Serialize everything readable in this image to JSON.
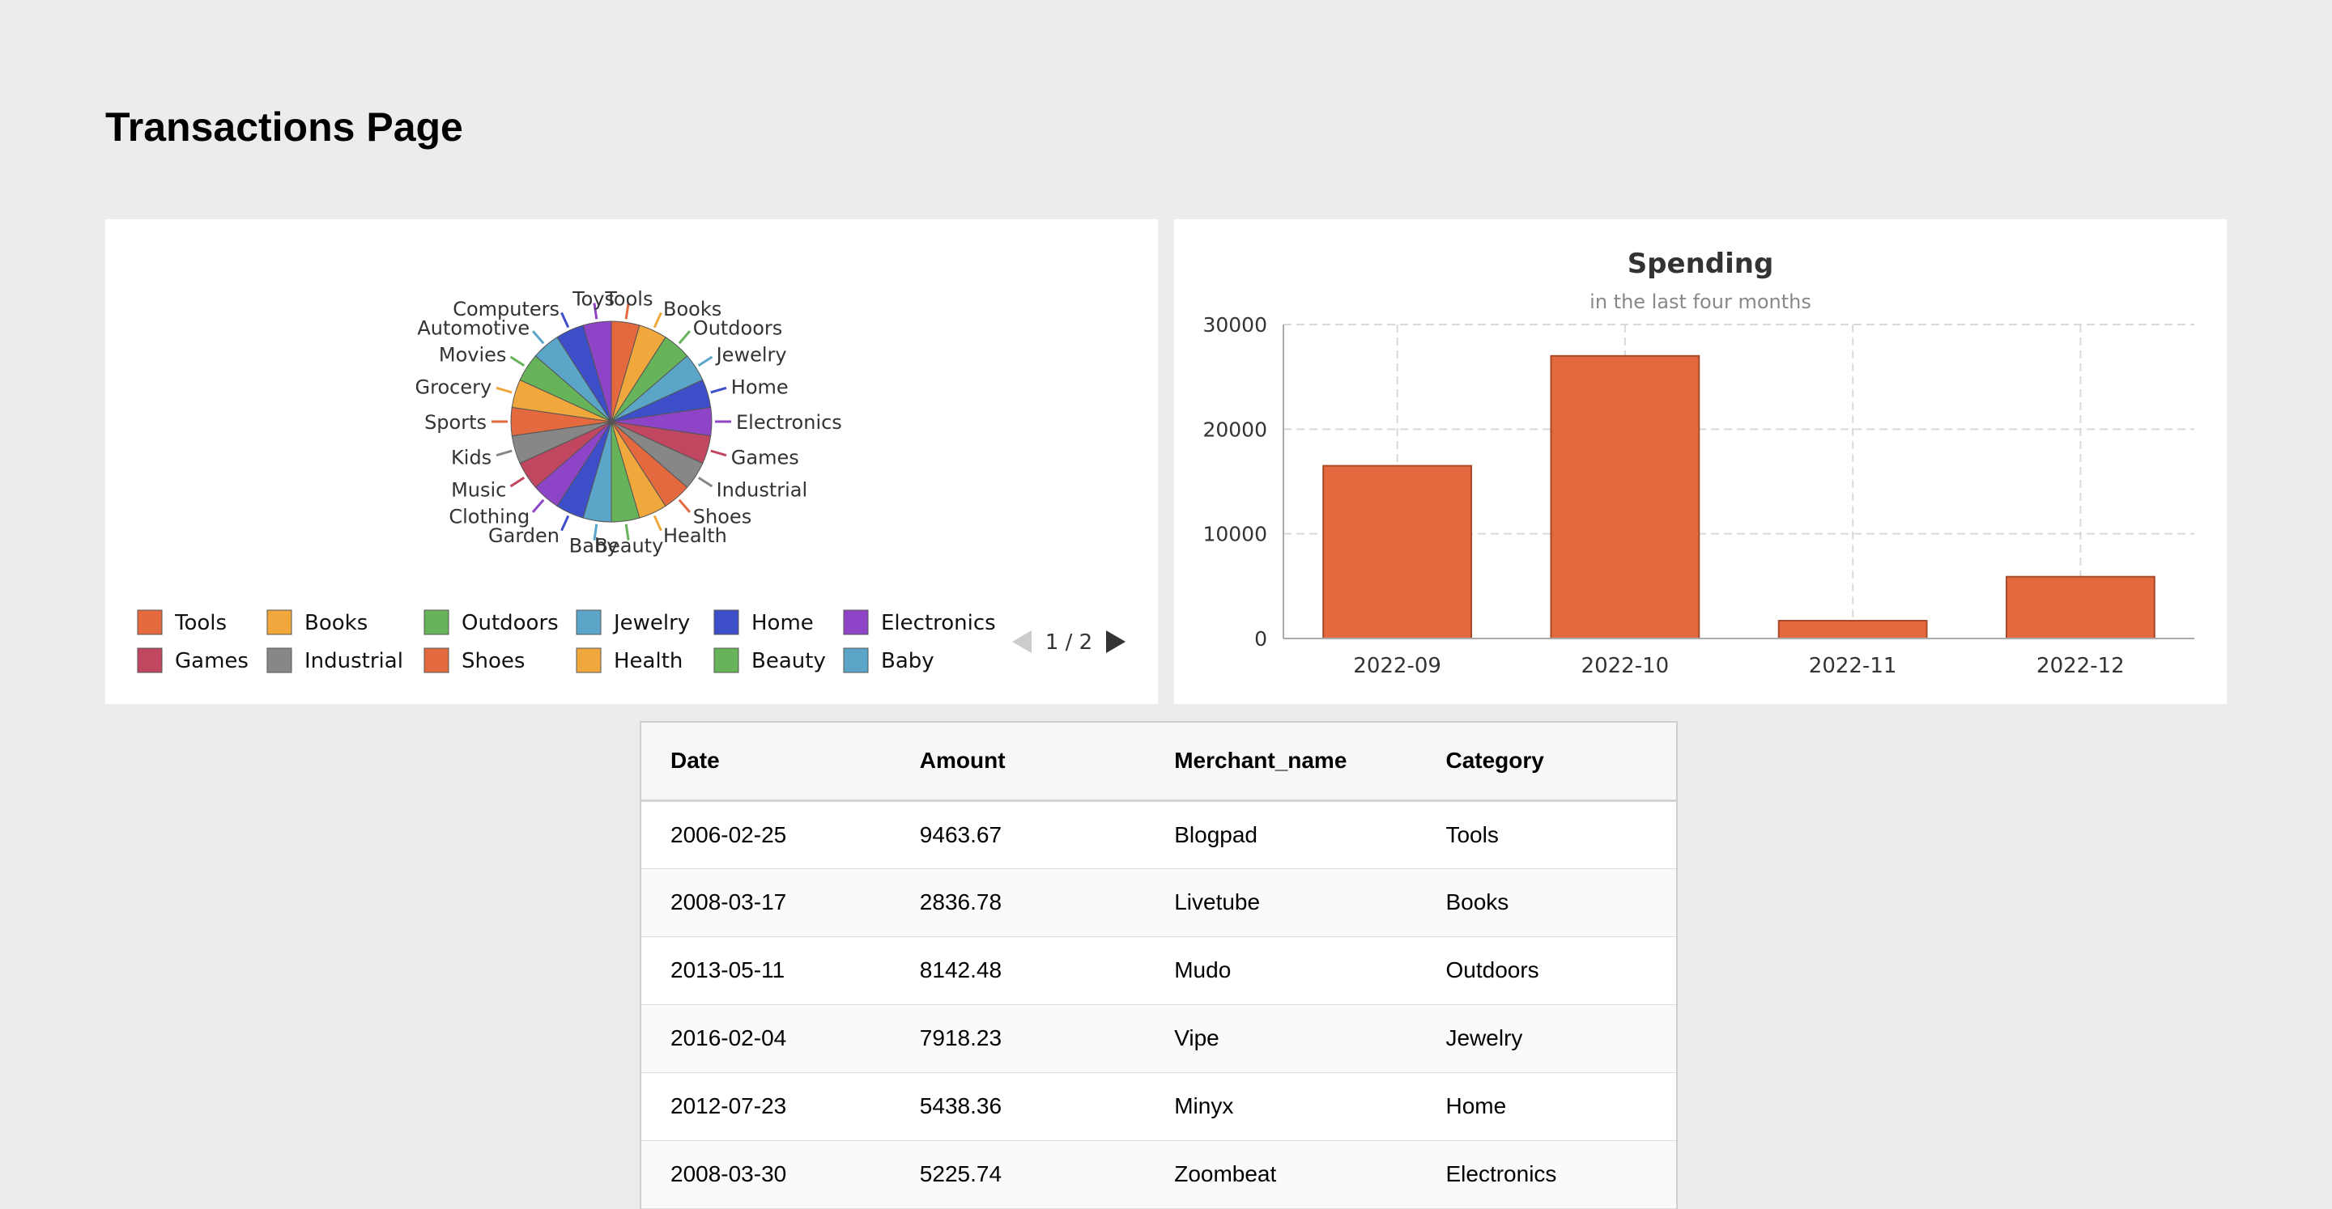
{
  "page": {
    "title": "Transactions Page"
  },
  "pie_panel": {
    "pager": {
      "text": "1 / 2"
    },
    "legend": [
      {
        "label": "Tools",
        "color": "#e4693e"
      },
      {
        "label": "Books",
        "color": "#f0a83c"
      },
      {
        "label": "Outdoors",
        "color": "#66b35a"
      },
      {
        "label": "Jewelry",
        "color": "#5aa5c8"
      },
      {
        "label": "Home",
        "color": "#3d4fc8"
      },
      {
        "label": "Electronics",
        "color": "#8e44c6"
      },
      {
        "label": "Games",
        "color": "#c0475f"
      },
      {
        "label": "Industrial",
        "color": "#878787"
      },
      {
        "label": "Shoes",
        "color": "#e4693e"
      },
      {
        "label": "Health",
        "color": "#f0a83c"
      },
      {
        "label": "Beauty",
        "color": "#66b35a"
      },
      {
        "label": "Baby",
        "color": "#5aa5c8"
      }
    ]
  },
  "chart_data": [
    {
      "type": "pie",
      "slices": [
        {
          "label": "Tools",
          "value": 1,
          "color": "#e4693e"
        },
        {
          "label": "Books",
          "value": 1,
          "color": "#f0a83c"
        },
        {
          "label": "Outdoors",
          "value": 1,
          "color": "#66b35a"
        },
        {
          "label": "Jewelry",
          "value": 1,
          "color": "#5aa5c8"
        },
        {
          "label": "Home",
          "value": 1,
          "color": "#3d4fc8"
        },
        {
          "label": "Electronics",
          "value": 1,
          "color": "#8e44c6"
        },
        {
          "label": "Games",
          "value": 1,
          "color": "#c0475f"
        },
        {
          "label": "Industrial",
          "value": 1,
          "color": "#878787"
        },
        {
          "label": "Shoes",
          "value": 1,
          "color": "#e4693e"
        },
        {
          "label": "Health",
          "value": 1,
          "color": "#f0a83c"
        },
        {
          "label": "Beauty",
          "value": 1,
          "color": "#66b35a"
        },
        {
          "label": "Baby",
          "value": 1,
          "color": "#5aa5c8"
        },
        {
          "label": "Garden",
          "value": 1,
          "color": "#3d4fc8"
        },
        {
          "label": "Clothing",
          "value": 1,
          "color": "#8e44c6"
        },
        {
          "label": "Music",
          "value": 1,
          "color": "#c0475f"
        },
        {
          "label": "Kids",
          "value": 1,
          "color": "#878787"
        },
        {
          "label": "Sports",
          "value": 1,
          "color": "#e4693e"
        },
        {
          "label": "Grocery",
          "value": 1,
          "color": "#f0a83c"
        },
        {
          "label": "Movies",
          "value": 1,
          "color": "#66b35a"
        },
        {
          "label": "Automotive",
          "value": 1,
          "color": "#5aa5c8"
        },
        {
          "label": "Computers",
          "value": 1,
          "color": "#3d4fc8"
        },
        {
          "label": "Toys",
          "value": 1,
          "color": "#8e44c6"
        }
      ]
    },
    {
      "type": "bar",
      "title": "Spending",
      "subtitle": "in the last four months",
      "categories": [
        "2022-09",
        "2022-10",
        "2022-11",
        "2022-12"
      ],
      "values": [
        16500,
        27000,
        1700,
        5900
      ],
      "ylim": [
        0,
        30000
      ],
      "yticks": [
        0,
        10000,
        20000,
        30000
      ],
      "grid": true,
      "color": "#e4693e"
    }
  ],
  "table": {
    "headers": [
      "Date",
      "Amount",
      "Merchant_name",
      "Category"
    ],
    "rows": [
      [
        "2006-02-25",
        "9463.67",
        "Blogpad",
        "Tools"
      ],
      [
        "2008-03-17",
        "2836.78",
        "Livetube",
        "Books"
      ],
      [
        "2013-05-11",
        "8142.48",
        "Mudo",
        "Outdoors"
      ],
      [
        "2016-02-04",
        "7918.23",
        "Vipe",
        "Jewelry"
      ],
      [
        "2012-07-23",
        "5438.36",
        "Minyx",
        "Home"
      ],
      [
        "2008-03-30",
        "5225.74",
        "Zoombeat",
        "Electronics"
      ]
    ]
  }
}
